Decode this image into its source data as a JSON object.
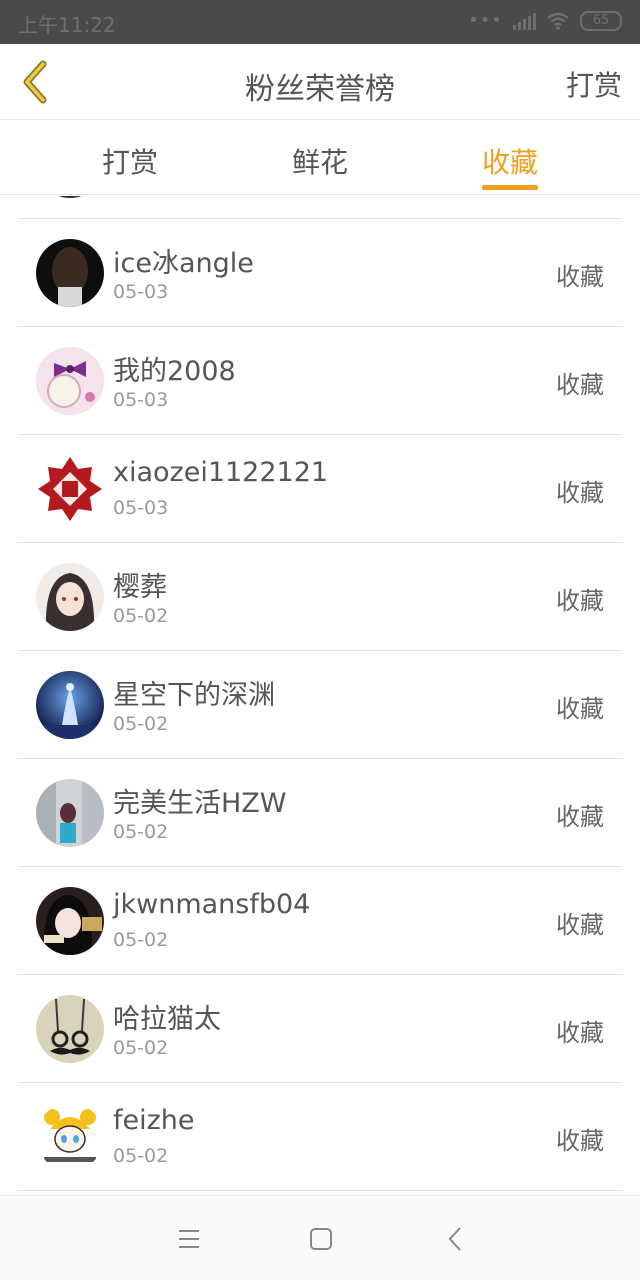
{
  "status_bar": {
    "time": "上午11:22",
    "battery": "65",
    "dots": "•••"
  },
  "header": {
    "title": "粉丝荣誉榜",
    "right_action": "打赏"
  },
  "tabs": [
    {
      "label": "打赏",
      "active": false
    },
    {
      "label": "鲜花",
      "active": false
    },
    {
      "label": "收藏",
      "active": true
    }
  ],
  "accent_color": "#f0a020",
  "list": [
    {
      "name": "ice冰angle",
      "date": "05-03",
      "action": "收藏",
      "avatar": "dark-hair-girl"
    },
    {
      "name": "我的2008",
      "date": "05-03",
      "action": "收藏",
      "avatar": "purple-bow-clock"
    },
    {
      "name": "xiaozei1122121",
      "date": "05-03",
      "action": "收藏",
      "avatar": "fu-paper-cut"
    },
    {
      "name": "樱葬",
      "date": "05-02",
      "action": "收藏",
      "avatar": "anime-girl"
    },
    {
      "name": "星空下的深渊",
      "date": "05-02",
      "action": "收藏",
      "avatar": "starry-night-figure"
    },
    {
      "name": "完美生活HZW",
      "date": "05-02",
      "action": "收藏",
      "avatar": "girl-street"
    },
    {
      "name": "jkwnmansfb04",
      "date": "05-02",
      "action": "收藏",
      "avatar": "girl-dark-hair-portrait"
    },
    {
      "name": "哈拉猫太",
      "date": "05-02",
      "action": "收藏",
      "avatar": "mustache-glasses"
    },
    {
      "name": "feizhe",
      "date": "05-02",
      "action": "收藏",
      "avatar": "cartoon-yellow-hair"
    }
  ]
}
